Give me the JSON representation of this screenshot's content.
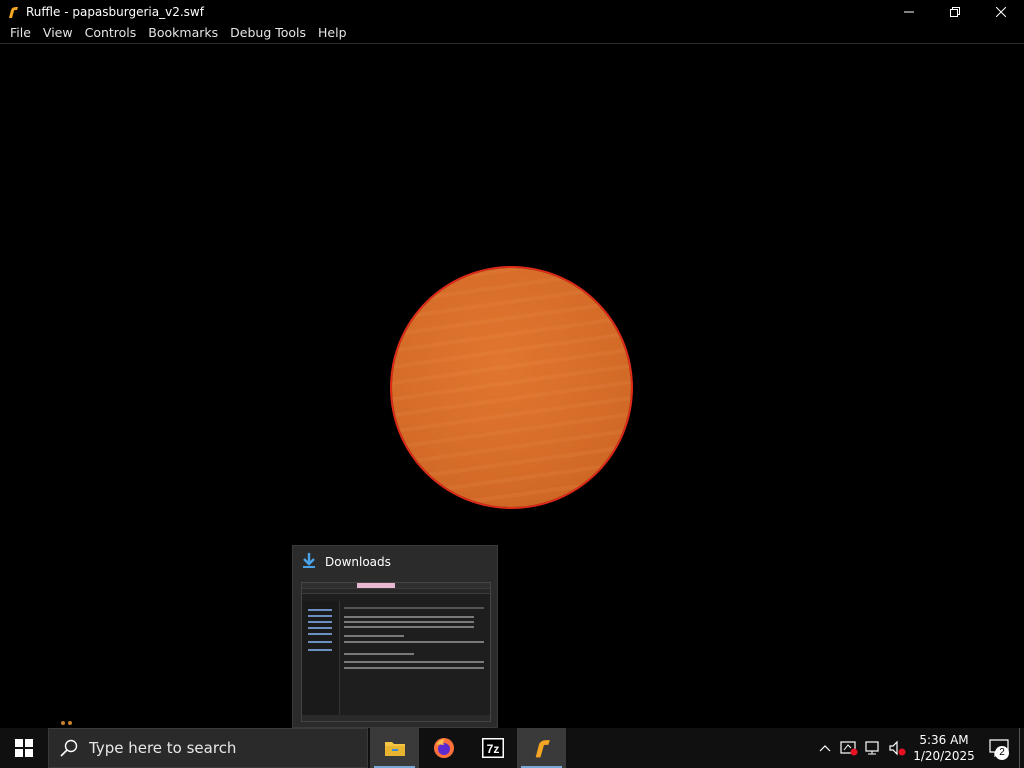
{
  "window": {
    "title": "Ruffle - papasburgeria_v2.swf",
    "icons": {
      "app": "ruffle-icon",
      "minimize": "minimize-icon",
      "restore": "restore-icon",
      "close": "close-icon"
    }
  },
  "menu": {
    "items": [
      "File",
      "View",
      "Controls",
      "Bookmarks",
      "Debug Tools",
      "Help"
    ]
  },
  "content": {
    "object": "orange-circle"
  },
  "thumbnail": {
    "title": "Downloads",
    "icon": "download-arrow-icon"
  },
  "taskbar": {
    "search_placeholder": "Type here to search",
    "apps": [
      {
        "name": "file-explorer-icon",
        "active": true
      },
      {
        "name": "firefox-icon",
        "active": false
      },
      {
        "name": "7zip-icon",
        "active": false
      },
      {
        "name": "ruffle-icon",
        "active": true
      }
    ],
    "tray": {
      "time": "5:36 AM",
      "date": "1/20/2025",
      "notifications": "2"
    }
  },
  "colors": {
    "accent_underline": "#7aa7d9",
    "patty": "#d46b28",
    "patty_outline": "#e02a18"
  }
}
